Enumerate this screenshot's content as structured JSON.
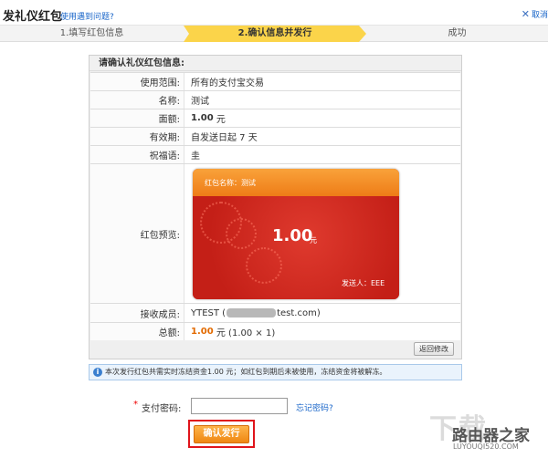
{
  "header": {
    "title": "发礼仪红包",
    "help_link": "使用遇到问题?",
    "close_label": "取消"
  },
  "steps": [
    {
      "label": "1.填写红包信息"
    },
    {
      "label": "2.确认信息并发行"
    },
    {
      "label": "成功"
    }
  ],
  "panel": {
    "heading": "请确认礼仪红包信息:",
    "rows": {
      "scope": {
        "label": "使用范围:",
        "value": "所有的支付宝交易"
      },
      "name": {
        "label": "名称:",
        "value": "测试"
      },
      "face": {
        "label": "面额:",
        "value": "1.00",
        "unit": "元"
      },
      "validity": {
        "label": "有效期:",
        "value": "自发送日起 7 天"
      },
      "greeting": {
        "label": "祝福语:",
        "value": "圭"
      },
      "preview": {
        "label": "红包预览:"
      },
      "recipients": {
        "label": "接收成员:",
        "value_prefix": "YTEST (",
        "value_suffix": "test.com)"
      },
      "total": {
        "label": "总额:",
        "amount": "1.00",
        "rest": "元 (1.00 × 1)"
      }
    },
    "back_button": "返回修改"
  },
  "card": {
    "name": "红包名称：测试",
    "amount": "1.00",
    "unit": "元",
    "sender": "发送人：EEE"
  },
  "notice": "本次发行红包共需实时冻结资金1.00 元；如红包到期后未被使用，冻结资金将被解冻。",
  "password": {
    "required_mark": "*",
    "label": "支付密码:",
    "forgot": "忘记密码?"
  },
  "confirm_button": "确认发行",
  "watermark": {
    "site_name": "路由器之家",
    "url": "LUYOUQI520.COM",
    "big_text": "下载"
  },
  "colors": {
    "accent": "#e26a00",
    "step_active": "#fbd44a",
    "card_red": "#d42a20",
    "highlight_border": "#e0141b"
  }
}
